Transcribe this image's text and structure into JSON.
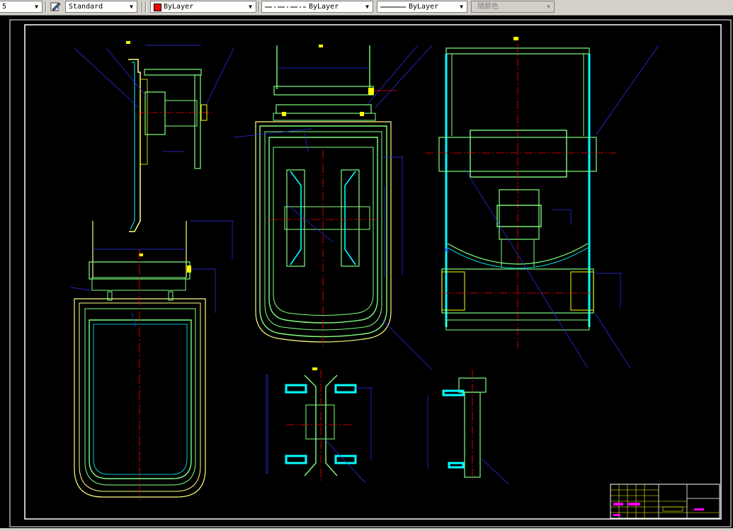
{
  "toolbar": {
    "dimstyle_value": "5",
    "textstyle_value": "Standard",
    "layer_color_value": "ByLayer",
    "linetype_value": "ByLayer",
    "lineweight_value": "ByLayer",
    "plotstyle_value": "随颜色"
  },
  "colors": {
    "canvas": "#000000",
    "cyan": "#00ffff",
    "yellow": "#ffff00",
    "green": "#7fff7f",
    "blue": "#3030ff",
    "red": "#ff0000",
    "magenta": "#ff00ff",
    "white": "#ffffff"
  }
}
